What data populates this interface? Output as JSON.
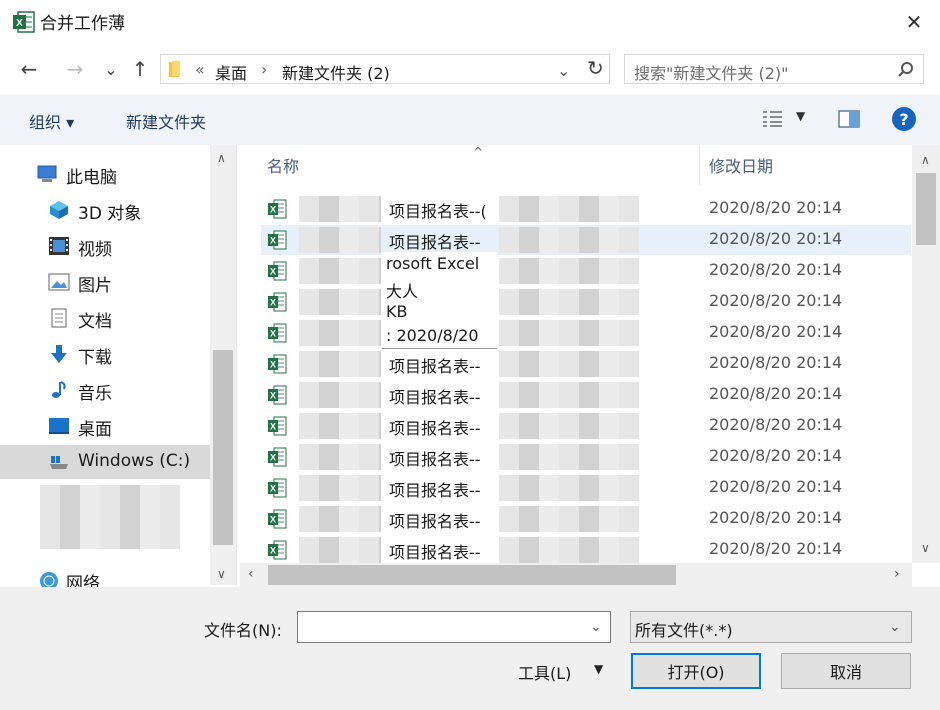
{
  "window": {
    "title": "合并工作薄",
    "close_glyph": "✕"
  },
  "nav": {
    "back_glyph": "←",
    "forward_glyph": "→",
    "recent_glyph": "⌄",
    "up_glyph": "↑",
    "breadcrumb": [
      "«",
      "桌面",
      "›",
      "新建文件夹 (2)"
    ],
    "refresh_glyph": "↻",
    "search_placeholder": "搜索\"新建文件夹 (2)\""
  },
  "toolbar": {
    "organize": "组织 ▾",
    "new_folder": "新建文件夹",
    "help": "?"
  },
  "sidebar": {
    "items": [
      {
        "label": "此电脑",
        "icon": "computer-icon",
        "selected": false
      },
      {
        "label": "3D 对象",
        "icon": "cube-3d-icon",
        "selected": false
      },
      {
        "label": "视频",
        "icon": "video-icon",
        "selected": false
      },
      {
        "label": "图片",
        "icon": "picture-icon",
        "selected": false
      },
      {
        "label": "文档",
        "icon": "document-icon",
        "selected": false
      },
      {
        "label": "下载",
        "icon": "download-icon",
        "selected": false
      },
      {
        "label": "音乐",
        "icon": "music-icon",
        "selected": false
      },
      {
        "label": "桌面",
        "icon": "desktop-icon",
        "selected": false
      },
      {
        "label": "Windows (C:)",
        "icon": "drive-icon",
        "selected": true
      },
      {
        "label": "网络",
        "icon": "network-icon",
        "selected": false
      }
    ]
  },
  "filelist": {
    "columns": {
      "name": "名称",
      "modified": "修改日期"
    },
    "rows": [
      {
        "name": "项目报名表--(",
        "date": "2020/8/20 20:14"
      },
      {
        "name": "项目报名表--",
        "date": "2020/8/20 20:14"
      },
      {
        "name": "",
        "date": "2020/8/20 20:14"
      },
      {
        "name": "",
        "date": "2020/8/20 20:14"
      },
      {
        "name": "",
        "date": "2020/8/20 20:14"
      },
      {
        "name": "项目报名表--",
        "date": "2020/8/20 20:14"
      },
      {
        "name": "项目报名表--",
        "date": "2020/8/20 20:14"
      },
      {
        "name": "项目报名表--",
        "date": "2020/8/20 20:14"
      },
      {
        "name": "项目报名表--",
        "date": "2020/8/20 20:14"
      },
      {
        "name": "项目报名表--",
        "date": "2020/8/20 20:14"
      },
      {
        "name": "项目报名表--",
        "date": "2020/8/20 20:14"
      },
      {
        "name": "项目报名表--",
        "date": "2020/8/20 20:14"
      }
    ],
    "tooltip": [
      "rosoft Excel",
      "大人",
      "KB",
      ": 2020/8/20"
    ]
  },
  "footer": {
    "filename_label": "文件名(N):",
    "filename_value": "",
    "filetype": "所有文件(*.*)",
    "tools": "工具(L)",
    "open": "打开(O)",
    "cancel": "取消"
  },
  "colors": {
    "accent": "#0078d7",
    "toolbar_bg": "#f0f4f9",
    "excel_green": "#217346"
  }
}
